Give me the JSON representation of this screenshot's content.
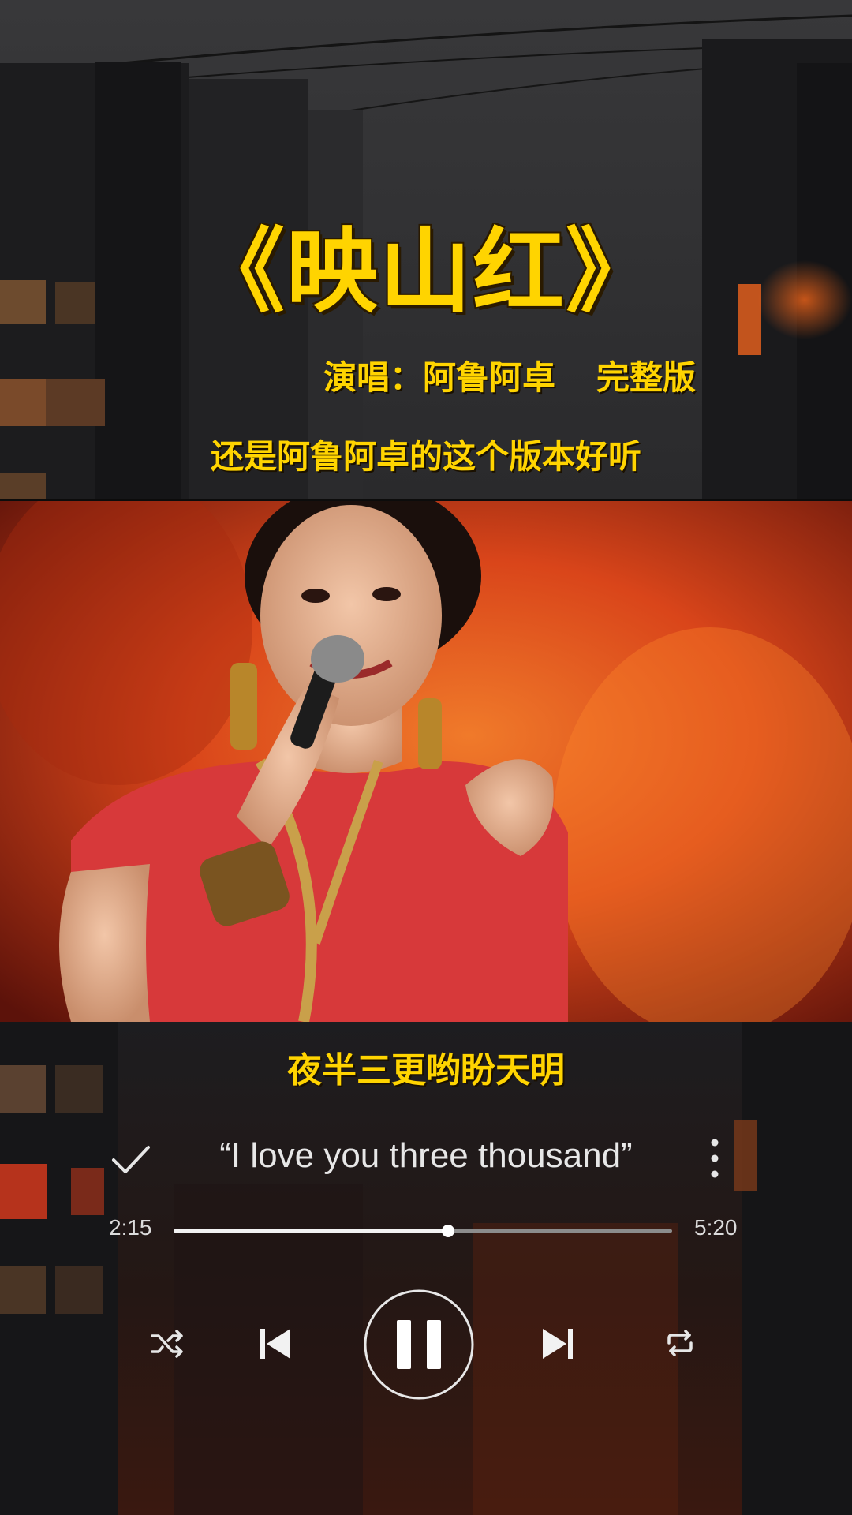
{
  "overlay": {
    "song_title": "《映山红》",
    "singer_label": "演唱：阿鲁阿卓",
    "version_label": "完整版",
    "comment": "还是阿鲁阿卓的这个版本好听",
    "lyric": "夜半三更哟盼天明"
  },
  "player": {
    "track_subtitle": "“I love you three thousand”",
    "time_elapsed": "2:15",
    "time_total": "5:20",
    "progress": 0.55,
    "is_playing": true
  },
  "icons": {
    "check": "check-icon",
    "more": "more-vertical-icon",
    "shuffle": "shuffle-icon",
    "previous": "skip-previous-icon",
    "pause": "pause-icon",
    "next": "skip-next-icon",
    "repeat": "repeat-icon"
  },
  "colors": {
    "overlay_text": "#ffd400",
    "player_text": "#e7e7e7",
    "video_background": "#d9451a"
  }
}
